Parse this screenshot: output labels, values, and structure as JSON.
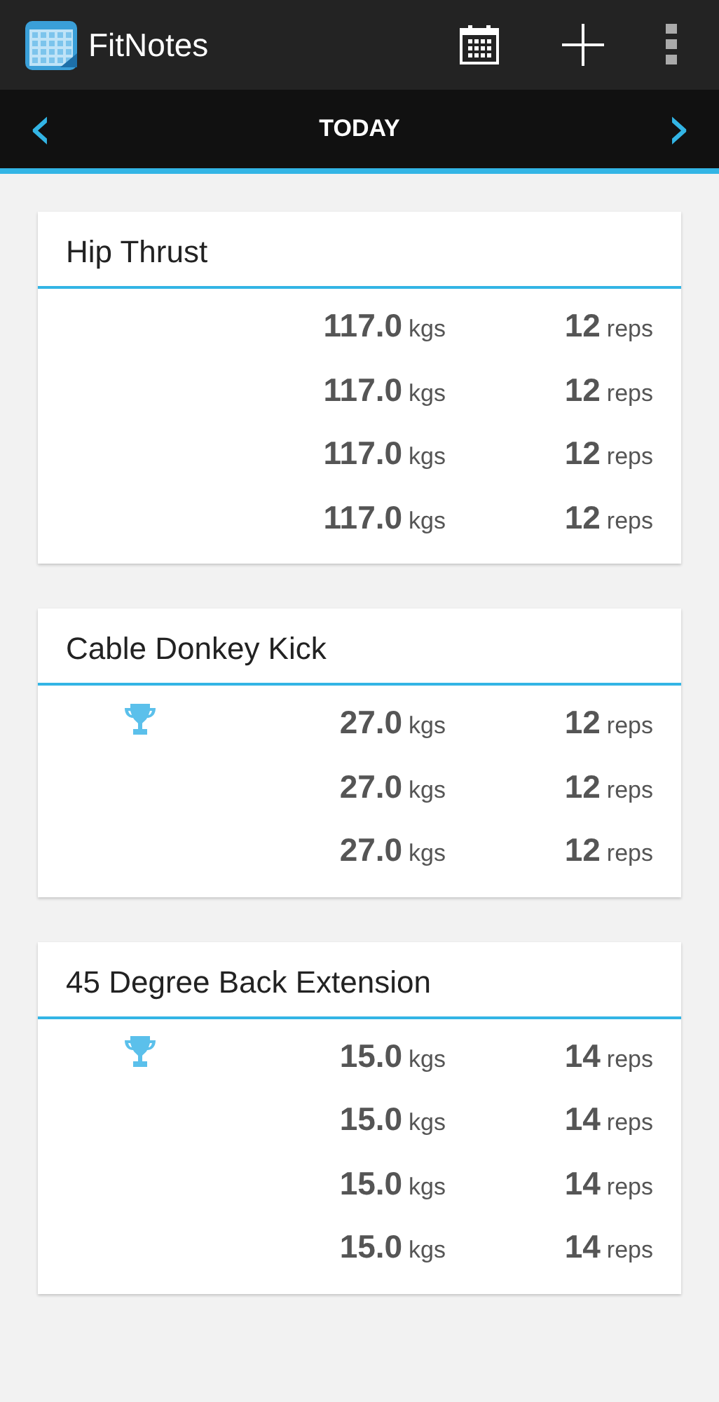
{
  "app_bar": {
    "title": "FitNotes"
  },
  "date_nav": {
    "label": "TODAY",
    "prev": "‹",
    "next": "›"
  },
  "exercises": [
    {
      "name": "Hip Thrust",
      "sets": [
        {
          "weight": "117.0",
          "weight_unit": "kgs",
          "reps": "12",
          "reps_unit": "reps",
          "record": false
        },
        {
          "weight": "117.0",
          "weight_unit": "kgs",
          "reps": "12",
          "reps_unit": "reps",
          "record": false
        },
        {
          "weight": "117.0",
          "weight_unit": "kgs",
          "reps": "12",
          "reps_unit": "reps",
          "record": false
        },
        {
          "weight": "117.0",
          "weight_unit": "kgs",
          "reps": "12",
          "reps_unit": "reps",
          "record": false
        }
      ]
    },
    {
      "name": "Cable Donkey Kick",
      "sets": [
        {
          "weight": "27.0",
          "weight_unit": "kgs",
          "reps": "12",
          "reps_unit": "reps",
          "record": true
        },
        {
          "weight": "27.0",
          "weight_unit": "kgs",
          "reps": "12",
          "reps_unit": "reps",
          "record": false
        },
        {
          "weight": "27.0",
          "weight_unit": "kgs",
          "reps": "12",
          "reps_unit": "reps",
          "record": false
        }
      ]
    },
    {
      "name": "45 Degree Back Extension",
      "sets": [
        {
          "weight": "15.0",
          "weight_unit": "kgs",
          "reps": "14",
          "reps_unit": "reps",
          "record": true
        },
        {
          "weight": "15.0",
          "weight_unit": "kgs",
          "reps": "14",
          "reps_unit": "reps",
          "record": false
        },
        {
          "weight": "15.0",
          "weight_unit": "kgs",
          "reps": "14",
          "reps_unit": "reps",
          "record": false
        },
        {
          "weight": "15.0",
          "weight_unit": "kgs",
          "reps": "14",
          "reps_unit": "reps",
          "record": false
        }
      ]
    }
  ]
}
